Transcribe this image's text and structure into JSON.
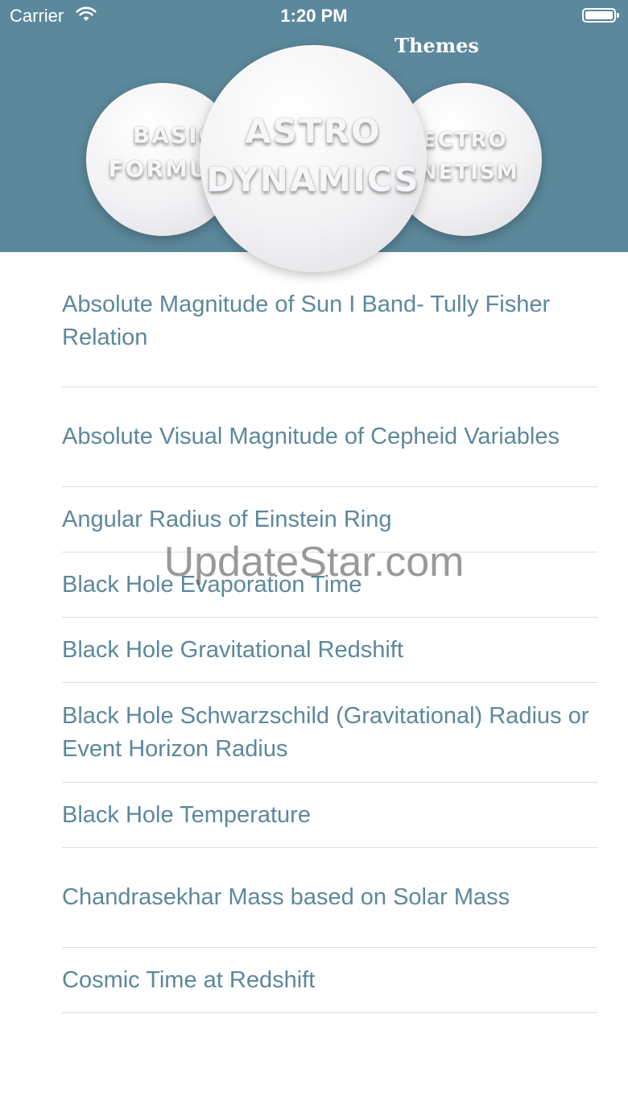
{
  "status_bar": {
    "carrier": "Carrier",
    "time": "1:20 PM"
  },
  "header": {
    "themes_label": "Themes",
    "themes": [
      {
        "lines": [
          "BASIC",
          "FORMUL"
        ]
      },
      {
        "lines": [
          "ASTRO",
          "DYNAMICS"
        ]
      },
      {
        "lines": [
          "LECTRO",
          "AGNETISM"
        ]
      }
    ]
  },
  "list": {
    "items": [
      "Absolute Magnitude of Sun I Band- Tully Fisher Relation",
      "Absolute Visual Magnitude of Cepheid Variables",
      "Angular Radius of Einstein Ring",
      "Black Hole Evaporation Time",
      "Black Hole Gravitational Redshift",
      "Black Hole Schwarzschild (Gravitational) Radius  or Event Horizon Radius",
      "Black Hole Temperature",
      "Chandrasekhar Mass based on Solar Mass",
      "Cosmic Time at Redshift"
    ]
  },
  "watermark": "UpdateStar.com",
  "colors": {
    "header_bg": "#5c889c",
    "item_text": "#5c889c",
    "divider": "#dedede"
  }
}
